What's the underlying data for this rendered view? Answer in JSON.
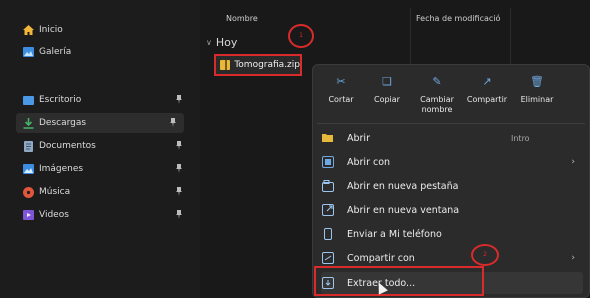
{
  "sidebar": {
    "top_items": [
      {
        "label": "Inicio",
        "icon": "home-icon"
      },
      {
        "label": "Galería",
        "icon": "gallery-icon"
      }
    ],
    "pinned_items": [
      {
        "label": "Escritorio",
        "icon": "desktop-icon"
      },
      {
        "label": "Descargas",
        "icon": "download-icon"
      },
      {
        "label": "Documentos",
        "icon": "document-icon"
      },
      {
        "label": "Imágenes",
        "icon": "image-icon"
      },
      {
        "label": "Música",
        "icon": "music-icon"
      },
      {
        "label": "Videos",
        "icon": "video-icon"
      }
    ]
  },
  "file_list": {
    "col_name": "Nombre",
    "col_date": "Fecha de modificació",
    "group_label": "Hoy",
    "file_name": "Tomografia.zip",
    "date_partial": "",
    "type_label": "Intro"
  },
  "annotations": {
    "step1": "1",
    "step2": "2",
    "color": "#d92b2b"
  },
  "context_menu": {
    "quick_actions": [
      {
        "label": "Cortar",
        "icon": "scissors-icon"
      },
      {
        "label": "Copiar",
        "icon": "copy-icon"
      },
      {
        "label": "Cambiar nombre",
        "icon": "rename-icon"
      },
      {
        "label": "Compartir",
        "icon": "share-icon"
      },
      {
        "label": "Eliminar",
        "icon": "trash-icon"
      }
    ],
    "items": [
      {
        "label": "Abrir",
        "shortcut": "Intro",
        "icon": "folder-open-icon"
      },
      {
        "label": "Abrir con",
        "icon": "open-with-icon",
        "submenu": true
      },
      {
        "label": "Abrir en nueva pestaña",
        "icon": "new-tab-icon"
      },
      {
        "label": "Abrir en nueva ventana",
        "icon": "new-window-icon"
      },
      {
        "label": "Enviar a Mi teléfono",
        "icon": "phone-icon"
      },
      {
        "label": "Compartir con",
        "icon": "share-with-icon",
        "submenu": true
      },
      {
        "label": "Extraer todo...",
        "icon": "extract-icon"
      }
    ]
  }
}
